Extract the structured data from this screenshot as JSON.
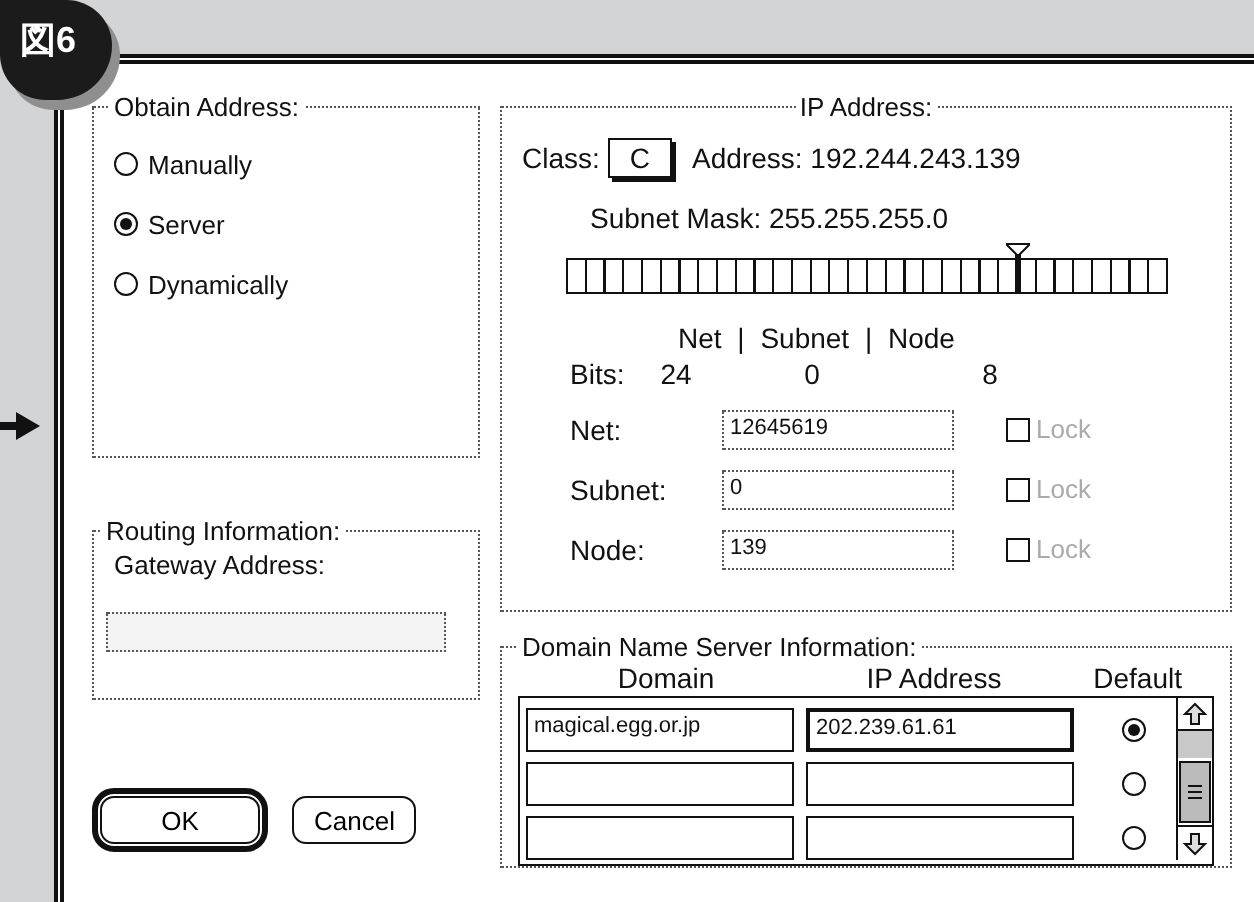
{
  "badge": {
    "label": "図6"
  },
  "obtain_address": {
    "title": "Obtain Address:",
    "options": [
      {
        "label": "Manually",
        "selected": false
      },
      {
        "label": "Server",
        "selected": true
      },
      {
        "label": "Dynamically",
        "selected": false
      }
    ]
  },
  "routing": {
    "title": "Routing Information:",
    "gateway_label": "Gateway Address:",
    "gateway_field": {
      "disabled": true
    }
  },
  "ip_address": {
    "title": "IP Address:",
    "class_label": "Class:",
    "class_value": "C",
    "address": "Address: 192.244.243.139",
    "subnet_mask": "Subnet Mask: 255.255.255.0",
    "slider": {
      "level": 0.75
    },
    "bits_header": "Net | Subnet | Node",
    "bits_label": "Bits:",
    "bits": [
      "24",
      "0",
      "8"
    ],
    "fields": [
      {
        "label": "Net:",
        "value": "12645619",
        "disabled": true,
        "lock": "Lock",
        "checked": false,
        "lock_disabled": true
      },
      {
        "label": "Subnet:",
        "value": "0",
        "disabled": true,
        "lock": "Lock",
        "checked": false,
        "lock_disabled": true
      },
      {
        "label": "Node:",
        "value": "139",
        "disabled": true,
        "lock": "Lock",
        "checked": false,
        "lock_disabled": true
      }
    ]
  },
  "dns": {
    "title": "Domain Name Server Information:",
    "columns": [
      "Domain",
      "IP Address",
      "Default"
    ],
    "rows": [
      {
        "domain": "magical.egg.or.jp",
        "ip": "202.239.61.61",
        "focused": true,
        "selected": true
      },
      {
        "focused": false,
        "selected": false
      },
      {
        "focused": false,
        "selected": false
      }
    ]
  },
  "buttons": [
    {
      "label": "OK",
      "default": true
    },
    {
      "label": "Cancel",
      "default": false
    }
  ]
}
